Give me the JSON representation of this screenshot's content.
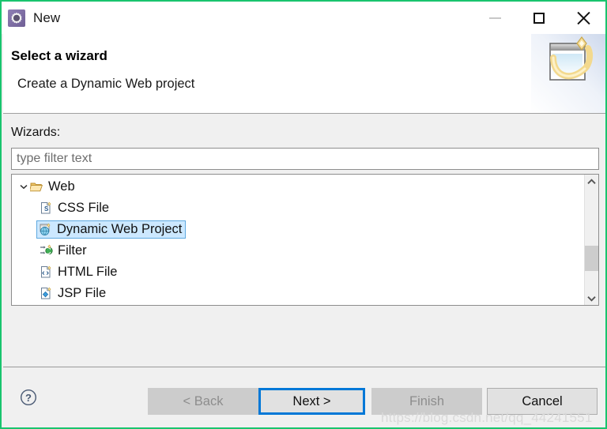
{
  "window": {
    "title": "New",
    "icon": "wizard-gear-icon",
    "border_color": "#19c46e",
    "controls": {
      "minimize": "minimize-icon",
      "maximize": "maximize-icon",
      "close": "close-icon"
    }
  },
  "header": {
    "title": "Select a wizard",
    "description": "Create a Dynamic Web project",
    "banner_icon": "wizard-banner-image"
  },
  "body": {
    "wizards_label": "Wizards:",
    "filter": {
      "value": "",
      "placeholder": "type filter text"
    },
    "tree": {
      "items": [
        {
          "label": "Web",
          "icon": "folder-open-icon",
          "level": 0,
          "expanded": true,
          "selected": false
        },
        {
          "label": "CSS File",
          "icon": "css-file-icon",
          "level": 1,
          "expanded": false,
          "selected": false
        },
        {
          "label": "Dynamic Web Project",
          "icon": "dynamic-web-project-icon",
          "level": 1,
          "expanded": false,
          "selected": true
        },
        {
          "label": "Filter",
          "icon": "filter-icon",
          "level": 1,
          "expanded": false,
          "selected": false
        },
        {
          "label": "HTML File",
          "icon": "html-file-icon",
          "level": 1,
          "expanded": false,
          "selected": false
        },
        {
          "label": "JSP File",
          "icon": "jsp-file-icon",
          "level": 1,
          "expanded": false,
          "selected": false
        }
      ],
      "scrollbar": {
        "up_icon": "chevron-up-icon",
        "down_icon": "chevron-down-icon"
      }
    }
  },
  "footer": {
    "help_icon": "help-question-icon",
    "buttons": [
      {
        "id": "back",
        "label": "< Back",
        "disabled": true,
        "focused": false
      },
      {
        "id": "next",
        "label": "Next >",
        "disabled": false,
        "focused": true
      },
      {
        "id": "finish",
        "label": "Finish",
        "disabled": true,
        "focused": false
      },
      {
        "id": "cancel",
        "label": "Cancel",
        "disabled": false,
        "focused": false
      }
    ]
  },
  "watermark": "https://blog.csdn.net/qq_44241551",
  "colors": {
    "window_border": "#19c46e",
    "selection_bg": "#cce8ff",
    "selection_border": "#5fa9e0",
    "focus_border": "#0078d7",
    "body_bg": "#f0f0f0",
    "disabled_text": "#8d8d8d"
  }
}
